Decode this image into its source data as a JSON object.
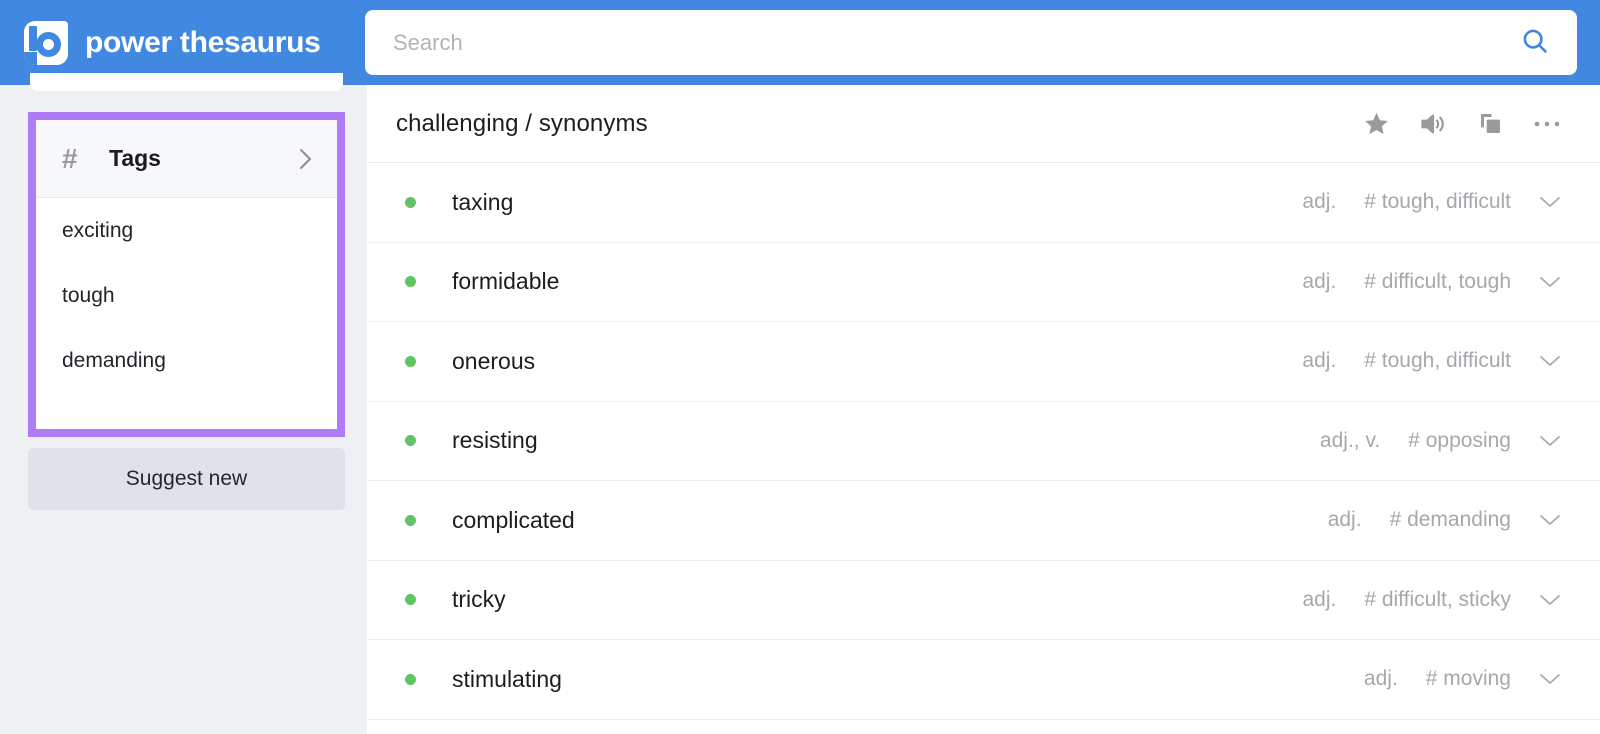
{
  "brand": {
    "name": "power thesaurus",
    "logo_icon": "power-thesaurus-b-logo"
  },
  "search": {
    "placeholder": "Search",
    "value": "",
    "submit_icon": "search-icon"
  },
  "sidebar": {
    "tags_panel": {
      "hash_icon": "#",
      "title": "Tags",
      "chevron_icon": "chevron-right-icon",
      "highlight_color": "#ae7cf7",
      "items": [
        {
          "label": "exciting"
        },
        {
          "label": "tough"
        },
        {
          "label": "demanding"
        }
      ]
    },
    "suggest_new_label": "Suggest new"
  },
  "main": {
    "title": "challenging / synonyms",
    "actions": [
      {
        "name": "favorite-star-icon",
        "label": "star"
      },
      {
        "name": "speaker-icon",
        "label": "pronounce"
      },
      {
        "name": "copy-icon",
        "label": "copy"
      },
      {
        "name": "more-options-icon",
        "label": "more"
      }
    ],
    "dot_color": "#63c364",
    "synonyms": [
      {
        "word": "taxing",
        "pos": "adj.",
        "tags": "# tough, difficult"
      },
      {
        "word": "formidable",
        "pos": "adj.",
        "tags": "# difficult, tough"
      },
      {
        "word": "onerous",
        "pos": "adj.",
        "tags": "# tough, difficult"
      },
      {
        "word": "resisting",
        "pos": "adj., v.",
        "tags": "# opposing"
      },
      {
        "word": "complicated",
        "pos": "adj.",
        "tags": "# demanding"
      },
      {
        "word": "tricky",
        "pos": "adj.",
        "tags": "# difficult, sticky"
      },
      {
        "word": "stimulating",
        "pos": "adj.",
        "tags": "# moving"
      }
    ]
  }
}
